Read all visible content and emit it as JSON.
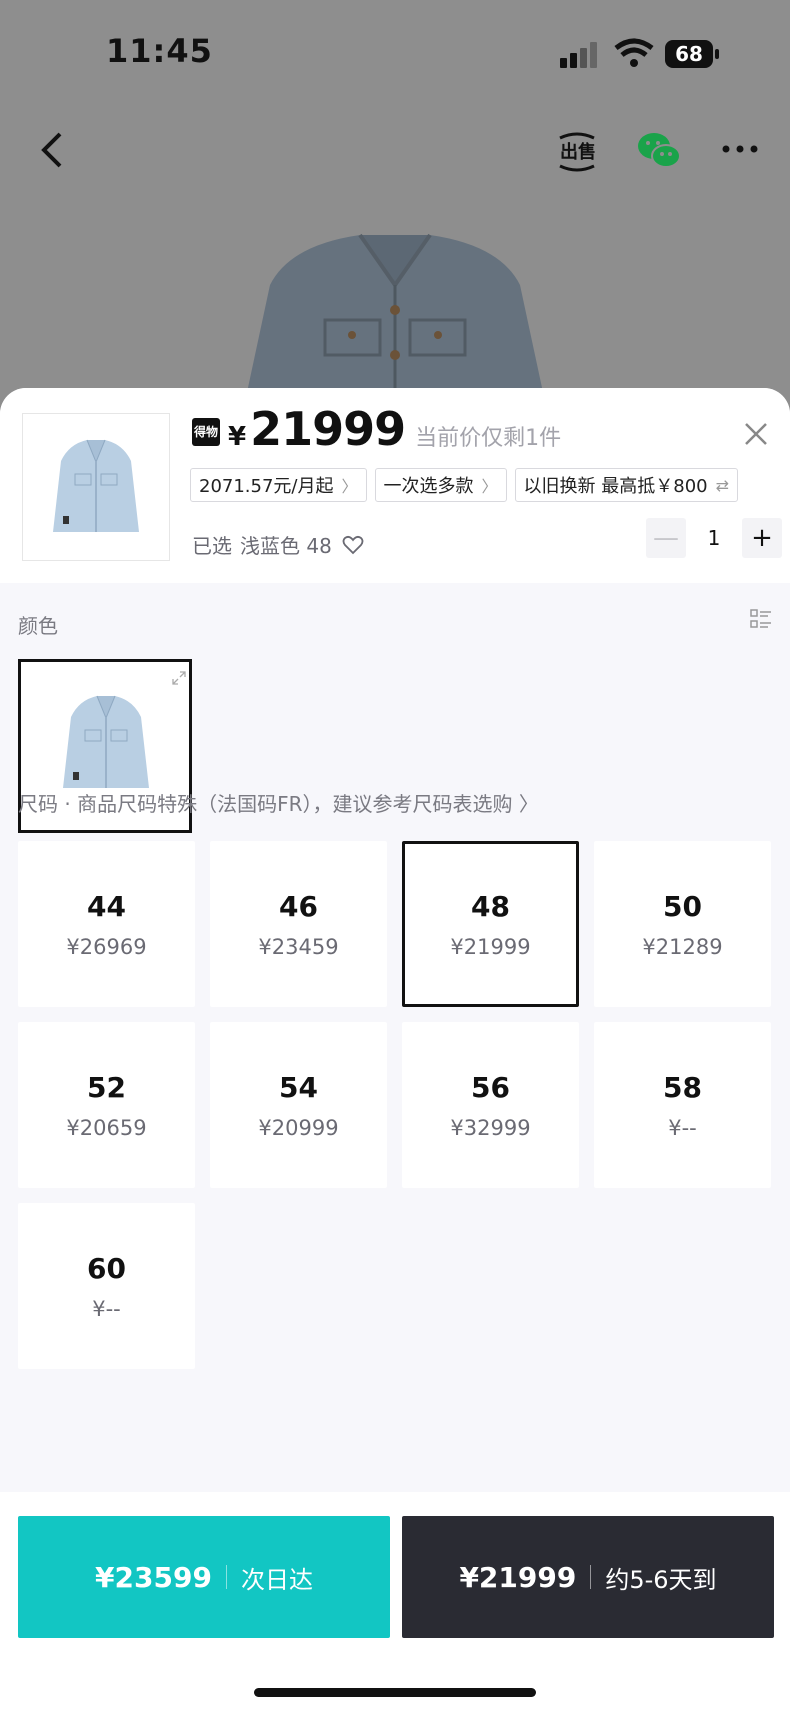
{
  "status": {
    "time": "11:45",
    "battery": "68"
  },
  "header": {
    "sell_icon": "sell-exchange-icon",
    "share_icon": "wechat-icon",
    "more_icon": "more-icon"
  },
  "product": {
    "brand_badge": "得物",
    "currency": "¥",
    "price": "21999",
    "stock_note": "当前价仅剩1件",
    "chips": [
      {
        "label": "2071.57元/月起",
        "chevron": "〉"
      },
      {
        "label": "一次选多款",
        "chevron": "〉"
      },
      {
        "label": "以旧换新 最高抵￥800",
        "chevron": "⇄"
      }
    ],
    "selected_prefix": "已选",
    "selected_value": "浅蓝色 48",
    "quantity": "1",
    "minus": "—",
    "plus": "+"
  },
  "color_section": {
    "label": "颜色"
  },
  "size_section": {
    "label": "尺码 · 商品尺码特殊（法国码FR），建议参考尺码表选购 〉",
    "sizes": [
      {
        "size": "44",
        "price": "¥26969",
        "selected": false
      },
      {
        "size": "46",
        "price": "¥23459",
        "selected": false
      },
      {
        "size": "48",
        "price": "¥21999",
        "selected": true
      },
      {
        "size": "50",
        "price": "¥21289",
        "selected": false
      },
      {
        "size": "52",
        "price": "¥20659",
        "selected": false
      },
      {
        "size": "54",
        "price": "¥20999",
        "selected": false
      },
      {
        "size": "56",
        "price": "¥32999",
        "selected": false
      },
      {
        "size": "58",
        "price": "¥--",
        "selected": false
      },
      {
        "size": "60",
        "price": "¥--",
        "selected": false
      }
    ]
  },
  "actions": {
    "fast": {
      "price": "¥23599",
      "desc": "次日达",
      "color": "#12c6c3"
    },
    "standard": {
      "price": "¥21999",
      "desc": "约5-6天到",
      "color": "#2a2b33"
    }
  }
}
